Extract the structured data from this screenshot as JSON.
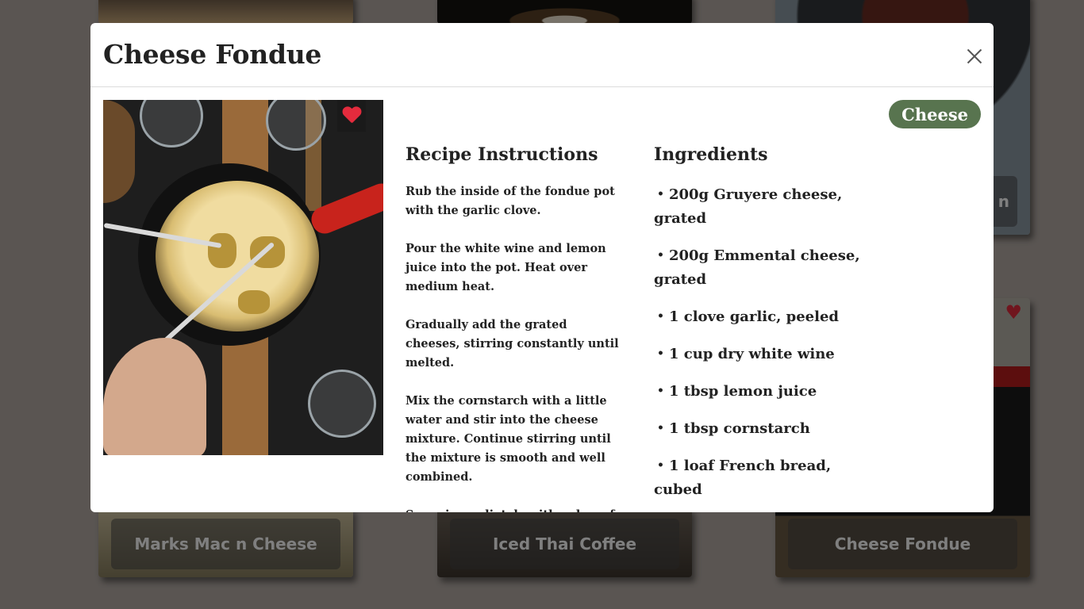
{
  "modal": {
    "title": "Cheese Fondue",
    "tag": "Cheese",
    "instructions_title": "Recipe Instructions",
    "instructions": [
      "Rub the inside of the fondue pot with the garlic clove.",
      "Pour the white wine and lemon juice into the pot. Heat over medium heat.",
      "Gradually add the grated cheeses, stirring constantly until melted.",
      "Mix the cornstarch with a little water and stir into the cheese mixture. Continue stirring until the mixture is smooth and well combined.",
      "Serve immediately with cubes of French bread for dipping."
    ],
    "ingredients_title": "Ingredients",
    "ingredients": [
      "200g Gruyere cheese, grated",
      "200g Emmental cheese, grated",
      "1 clove garlic, peeled",
      "1 cup dry white wine",
      "1 tbsp lemon juice",
      "1 tbsp cornstarch",
      "1 loaf French bread, cubed"
    ],
    "favorite_icon": "heart-icon",
    "close_icon": "close-icon"
  },
  "background_cards": [
    {
      "label": ""
    },
    {
      "label": ""
    },
    {
      "label": "n"
    },
    {
      "label": "Marks Mac n Cheese"
    },
    {
      "label": "Iced Thai Coffee"
    },
    {
      "label": "Cheese Fondue"
    }
  ],
  "colors": {
    "tag_bg": "#58744f",
    "heart": "#e42b3d",
    "overlay": "rgba(0,0,0,0.5)"
  }
}
